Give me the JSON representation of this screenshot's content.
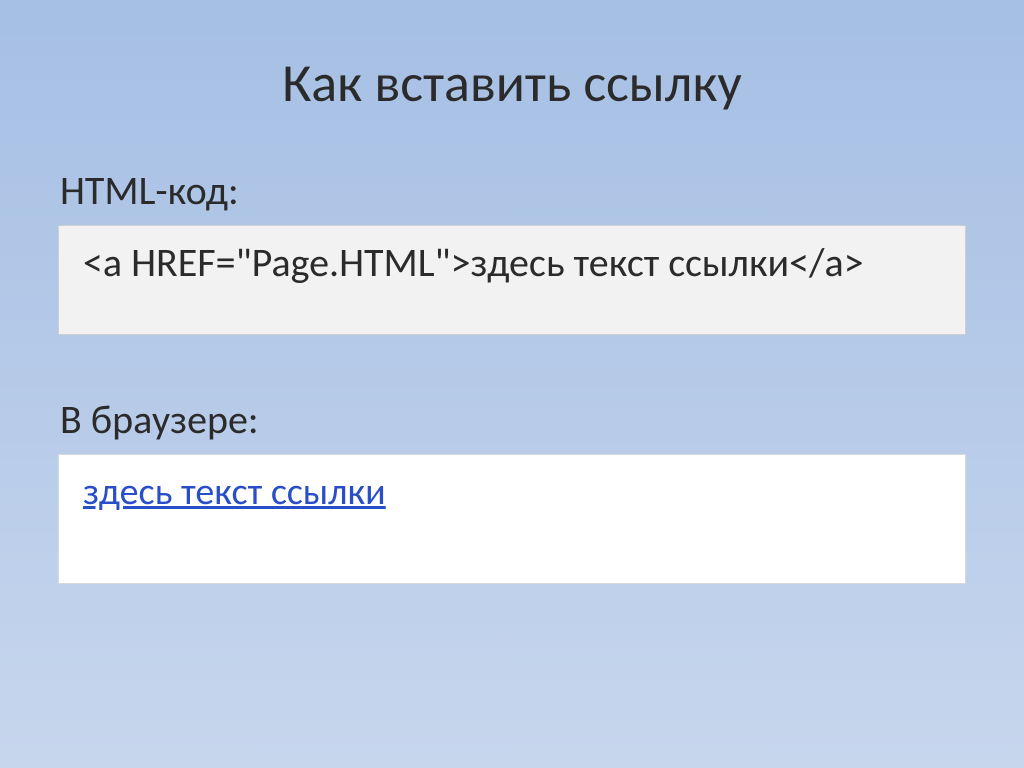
{
  "title": "Как вставить ссылку",
  "code_label": "HTML-код:",
  "code_text": "<a HREF=\"Page.HTML\">здесь текст ссылки</a>",
  "browser_label": "В браузере:",
  "link_text": "здесь текст ссылки"
}
